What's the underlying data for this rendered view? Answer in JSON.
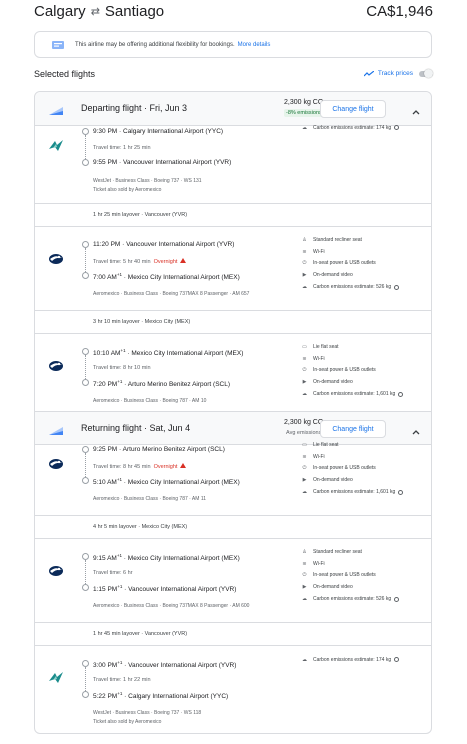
{
  "header": {
    "origin": "Calgary",
    "destination": "Santiago",
    "swap_icon": "swap-arrows-icon",
    "price": "CA$1,946"
  },
  "notice": {
    "text": "This airline may be offering additional flexibility for bookings.",
    "link": "More details"
  },
  "selected_label": "Selected flights",
  "track": {
    "label": "Track prices",
    "on": false
  },
  "departing": {
    "title": "Departing flight",
    "date": "Fri, Jun 3",
    "co2": "2,300 kg CO",
    "co2_sub": "2",
    "emissions": "-8% emissions",
    "change_label": "Change flight",
    "segments": [
      {
        "airline_logo": "westjet-logo",
        "dep_time": "9:30 PM",
        "dep_sup": "",
        "dep_airport": "Calgary International Airport (YYC)",
        "travel_time": "Travel time: 1 hr 25 min",
        "overnight": "",
        "arr_time": "9:55 PM",
        "arr_sup": "",
        "arr_airport": "Vancouver International Airport (YVR)",
        "meta1": "WestJet · Business Class · Boeing 737 · WS 131",
        "meta2": "Ticket also sold by Aeromexico",
        "amenities": [
          {
            "icon": "co2-icon",
            "text": "Carbon emissions estimate: 174 kg",
            "info": true
          }
        ]
      },
      {
        "airline_logo": "aeromexico-logo",
        "dep_time": "11:20 PM",
        "dep_sup": "",
        "dep_airport": "Vancouver International Airport (YVR)",
        "travel_time": "Travel time: 5 hr 40 min",
        "overnight": "Overnight",
        "arr_time": "7:00 AM",
        "arr_sup": "+1",
        "arr_airport": "Mexico City International Airport (MEX)",
        "meta1": "Aeromexico · Business Class · Boeing 737MAX 8 Passenger · AM 657",
        "meta2": "",
        "amenities": [
          {
            "icon": "recliner-seat-icon",
            "text": "Standard recliner seat"
          },
          {
            "icon": "wifi-icon",
            "text": "Wi-Fi"
          },
          {
            "icon": "power-outlet-icon",
            "text": "In-seat power & USB outlets"
          },
          {
            "icon": "video-icon",
            "text": "On-demand video"
          },
          {
            "icon": "co2-icon",
            "text": "Carbon emissions estimate: 526 kg",
            "info": true
          }
        ]
      },
      {
        "airline_logo": "aeromexico-logo",
        "dep_time": "10:10 AM",
        "dep_sup": "+1",
        "dep_airport": "Mexico City International Airport (MEX)",
        "travel_time": "Travel time: 8 hr 10 min",
        "overnight": "",
        "arr_time": "7:20 PM",
        "arr_sup": "+1",
        "arr_airport": "Arturo Merino Benitez Airport (SCL)",
        "meta1": "Aeromexico · Business Class · Boeing 787 · AM 10",
        "meta2": "",
        "amenities": [
          {
            "icon": "flat-seat-icon",
            "text": "Lie flat seat"
          },
          {
            "icon": "wifi-icon",
            "text": "Wi-Fi"
          },
          {
            "icon": "power-outlet-icon",
            "text": "In-seat power & USB outlets"
          },
          {
            "icon": "video-icon",
            "text": "On-demand video"
          },
          {
            "icon": "co2-icon",
            "text": "Carbon emissions estimate: 1,601 kg",
            "info": true
          }
        ]
      }
    ],
    "layovers": [
      "1 hr 25 min layover · Vancouver (YVR)",
      "3 hr 10 min layover · Mexico City (MEX)"
    ]
  },
  "returning": {
    "title": "Returning flight",
    "date": "Sat, Jun 4",
    "co2": "2,300 kg CO",
    "co2_sub": "2",
    "emissions": "Avg emissions",
    "change_label": "Change flight",
    "segments": [
      {
        "airline_logo": "aeromexico-logo",
        "dep_time": "9:25 PM",
        "dep_sup": "",
        "dep_airport": "Arturo Merino Benitez Airport (SCL)",
        "travel_time": "Travel time: 8 hr 45 min",
        "overnight": "Overnight",
        "arr_time": "5:10 AM",
        "arr_sup": "+1",
        "arr_airport": "Mexico City International Airport (MEX)",
        "meta1": "Aeromexico · Business Class · Boeing 787 · AM 11",
        "meta2": "",
        "amenities": [
          {
            "icon": "flat-seat-icon",
            "text": "Lie flat seat"
          },
          {
            "icon": "wifi-icon",
            "text": "Wi-Fi"
          },
          {
            "icon": "power-outlet-icon",
            "text": "In-seat power & USB outlets"
          },
          {
            "icon": "video-icon",
            "text": "On-demand video"
          },
          {
            "icon": "co2-icon",
            "text": "Carbon emissions estimate: 1,601 kg",
            "info": true
          }
        ]
      },
      {
        "airline_logo": "aeromexico-logo",
        "dep_time": "9:15 AM",
        "dep_sup": "+1",
        "dep_airport": "Mexico City International Airport (MEX)",
        "travel_time": "Travel time: 6 hr",
        "overnight": "",
        "arr_time": "1:15 PM",
        "arr_sup": "+1",
        "arr_airport": "Vancouver International Airport (YVR)",
        "meta1": "Aeromexico · Business Class · Boeing 737MAX 8 Passenger · AM 600",
        "meta2": "",
        "amenities": [
          {
            "icon": "recliner-seat-icon",
            "text": "Standard recliner seat"
          },
          {
            "icon": "wifi-icon",
            "text": "Wi-Fi"
          },
          {
            "icon": "power-outlet-icon",
            "text": "In-seat power & USB outlets"
          },
          {
            "icon": "video-icon",
            "text": "On-demand video"
          },
          {
            "icon": "co2-icon",
            "text": "Carbon emissions estimate: 526 kg",
            "info": true
          }
        ]
      },
      {
        "airline_logo": "westjet-logo",
        "dep_time": "3:00 PM",
        "dep_sup": "+1",
        "dep_airport": "Vancouver International Airport (YVR)",
        "travel_time": "Travel time: 1 hr 22 min",
        "overnight": "",
        "arr_time": "5:22 PM",
        "arr_sup": "+1",
        "arr_airport": "Calgary International Airport (YYC)",
        "meta1": "WestJet · Business Class · Boeing 737 · WS 118",
        "meta2": "Ticket also sold by Aeromexico",
        "amenities": [
          {
            "icon": "co2-icon",
            "text": "Carbon emissions estimate: 174 kg",
            "info": true
          }
        ]
      }
    ],
    "layovers": [
      "4 hr 5 min layover · Mexico City (MEX)",
      "1 hr 45 min layover · Vancouver (YVR)"
    ]
  }
}
